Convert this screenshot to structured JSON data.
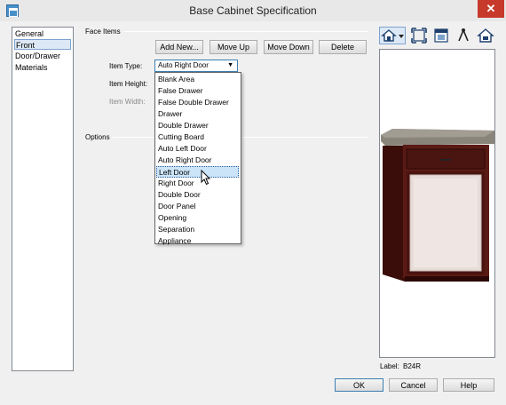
{
  "window": {
    "title": "Base Cabinet Specification",
    "close_symbol": "✕"
  },
  "sidebar": {
    "items": [
      {
        "label": "General",
        "selected": false
      },
      {
        "label": "Front",
        "selected": true
      },
      {
        "label": "Door/Drawer",
        "selected": false
      },
      {
        "label": "Materials",
        "selected": false
      }
    ]
  },
  "face_items": {
    "group_label": "Face Items",
    "buttons": {
      "add_new": "Add New...",
      "move_up": "Move Up",
      "move_down": "Move Down",
      "delete": "Delete"
    },
    "item_type_label": "Item Type:",
    "item_type_value": "Auto Right Door",
    "item_height_label": "Item Height:",
    "item_width_label": "Item Width:"
  },
  "options_group_label": "Options",
  "dropdown": {
    "options": [
      "Blank Area",
      "False Drawer",
      "False Double Drawer",
      "Drawer",
      "Double Drawer",
      "Cutting Board",
      "Auto Left Door",
      "Auto Right Door",
      "Left Door",
      "Right Door",
      "Double Door",
      "Door Panel",
      "Opening",
      "Separation",
      "Appliance"
    ],
    "highlighted": "Left Door"
  },
  "preview": {
    "toolbar_icons": [
      "camera-view-icon",
      "dropdown-arrow-icon",
      "fill-window-icon",
      "render-view-icon",
      "select-tool-icon",
      "camera-icon"
    ],
    "label_caption": "Label:",
    "label_value": "B24R"
  },
  "footer": {
    "ok": "OK",
    "cancel": "Cancel",
    "help": "Help"
  },
  "colors": {
    "accent": "#3c7fb1",
    "close": "#c7392b",
    "cabinet": "#5a1a14",
    "countertop": "#8a857a",
    "door_panel": "#e7dcd8"
  }
}
